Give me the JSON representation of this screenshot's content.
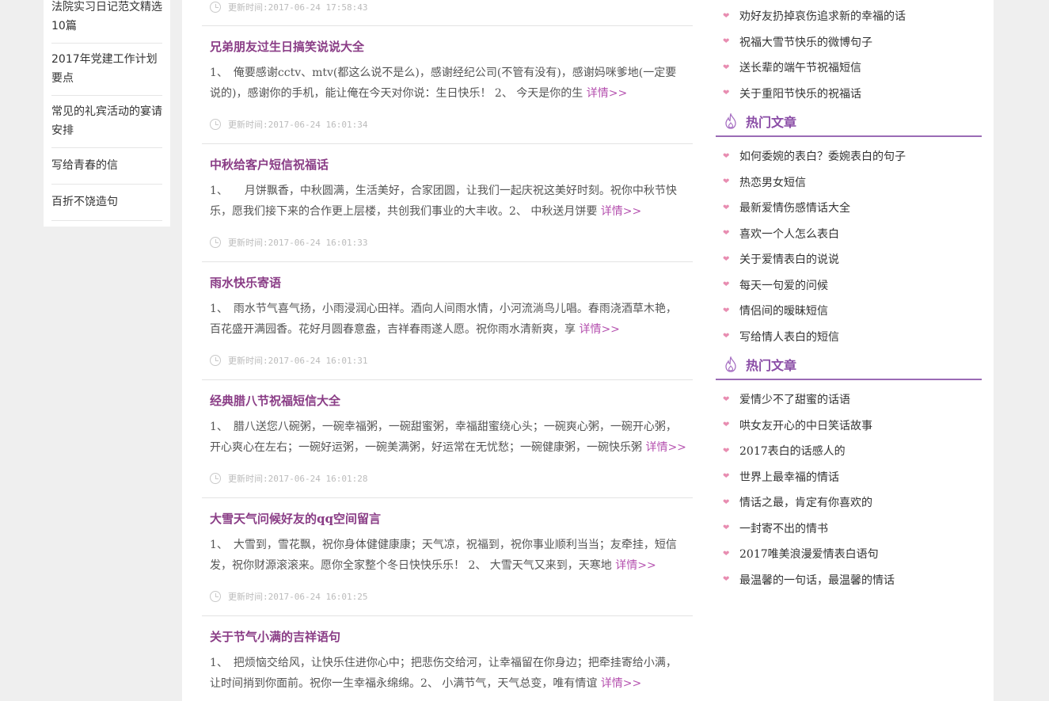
{
  "left_sidebar": {
    "items": [
      "法院实习日记范文精选10篇",
      "2017年党建工作计划要点",
      "常见的礼宾活动的宴请安排",
      "写给青春的信",
      "百折不饶造句"
    ]
  },
  "main": {
    "top_time": "更新时间:2017-06-24 17:58:43",
    "more_label": "详情>>",
    "articles": [
      {
        "title": "兄弟朋友过生日搞笑说说大全",
        "summary": "1、　俺要感谢cctv、mtv(都这么说不是么)，感谢经纪公司(不管有没有)，感谢妈咪爹地(一定要说的)，感谢你的手机，能让俺在今天对你说：生日快乐！ 2、 今天是你的生 ",
        "time": "更新时间:2017-06-24 16:01:34"
      },
      {
        "title": "中秋给客户短信祝福话",
        "summary": "1、　　月饼飘香，中秋圆满，生活美好，合家团圆，让我们一起庆祝这美好时刻。祝你中秋节快乐，愿我们接下来的合作更上层楼，共创我们事业的大丰收。2、 中秋送月饼要 ",
        "time": "更新时间:2017-06-24 16:01:33"
      },
      {
        "title": "雨水快乐寄语",
        "summary": "1、　雨水节气喜气扬，小雨浸润心田祥。酒向人间雨水情，小河流淌鸟儿唱。春雨浇酒草木艳，百花盛开满园香。花好月圆春意盎，吉祥春雨遂人愿。祝你雨水清新爽，享 ",
        "time": "更新时间:2017-06-24 16:01:31"
      },
      {
        "title": "经典腊八节祝福短信大全",
        "summary": "1、　腊八送您八碗粥，一碗幸福粥，一碗甜蜜粥，幸福甜蜜绕心头；一碗爽心粥，一碗开心粥，开心爽心在左右；一碗好运粥，一碗美满粥，好运常在无忧愁；一碗健康粥，一碗快乐粥 ",
        "time": "更新时间:2017-06-24 16:01:28"
      },
      {
        "title": "大雪天气问候好友的qq空间留言",
        "summary": "1、　大雪到，雪花飘，祝你身体健健康康；天气凉，祝福到，祝你事业顺利当当；友牵挂，短信发，祝你财源滚滚来。愿你全家整个冬日快快乐乐！ 2、 大雪天气又来到，天寒地 ",
        "time": "更新时间:2017-06-24 16:01:25"
      },
      {
        "title": "关于节气小满的吉祥语句",
        "summary": "1、　把烦恼交给风，让快乐住进你心中；把悲伤交给河，让幸福留在你身边；把牵挂寄给小满，让时间捎到你面前。祝你一生幸福永绵绵。2、 小满节气，天气总变，唯有情谊 ",
        "time": ""
      }
    ]
  },
  "right_sidebar": {
    "top_list": [
      "劝好友扔掉哀伤追求新的幸福的话",
      "祝福大雪节快乐的微博句子",
      "送长辈的端午节祝福短信",
      "关于重阳节快乐的祝福话"
    ],
    "sections": [
      {
        "heading": "热门文章",
        "items": [
          "如何委婉的表白？委婉表白的句子",
          "热恋男女短信",
          "最新爱情伤感情话大全",
          "喜欢一个人怎么表白",
          "关于爱情表白的说说",
          "每天一句爱的问候",
          "情侣间的暧昧短信",
          "写给情人表白的短信"
        ]
      },
      {
        "heading": "热门文章",
        "items": [
          "爱情少不了甜蜜的话语",
          "哄女友开心的中日笑话故事",
          "2017表白的话感人的",
          "世界上最幸福的情话",
          "情话之最，肯定有你喜欢的",
          "一封寄不出的情书",
          "2017唯美浪漫爱情表白语句",
          "最温馨的一句话，最温馨的情话"
        ]
      }
    ]
  },
  "colors": {
    "title": "#8a3d86",
    "more_link": "#b44fae",
    "heading": "#8a4da6",
    "heading_rule": "#9a6bb5",
    "heart": "#e88db1"
  }
}
